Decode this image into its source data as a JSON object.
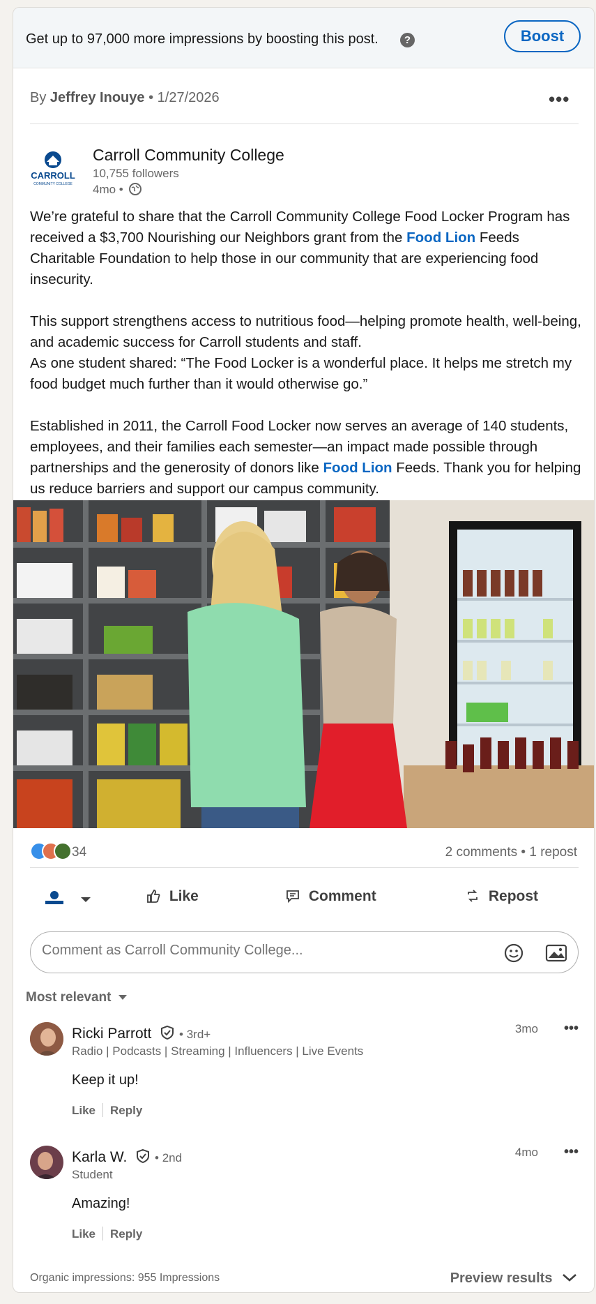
{
  "boost_bar": {
    "text": "Get up to 97,000 more impressions by boosting this post.",
    "help_icon": "question-circle-icon",
    "button": "Boost"
  },
  "byline": {
    "prefix": "By",
    "author": "Jeffrey Inouye",
    "sep": "•",
    "date": "1/27/2026"
  },
  "org": {
    "logo_text": "CARROLL",
    "logo_subtext": "COMMUNITY COLLEGE",
    "name": "Carroll Community College",
    "followers": "10,755 followers",
    "age": "4mo •"
  },
  "post": {
    "p1_a": "We’re grateful to share that the Carroll Community College Food Locker Program has received a $3,700 Nourishing our Neighbors grant from the ",
    "p1_link": "Food Lion",
    "p1_b": " Feeds Charitable Foundation to help those in our community that are experiencing food insecurity.",
    "p2_line1": "This support strengthens access to nutritious food—helping promote health, well-being, and academic success for Carroll students and staff.",
    "p2_line2": "As one student shared: “The Food Locker is a wonderful place. It helps me stretch my food budget much further than it would otherwise go.”",
    "p3_a": "Established in 2011, the Carroll Food Locker now serves an average of 140 students, employees, and their families each semester—an impact made possible through partnerships and the generosity of donors like ",
    "p3_link": "Food Lion",
    "p3_b": " Feeds. Thank you for helping us reduce barriers and support our campus community."
  },
  "social": {
    "reaction_count": "34",
    "comments_reposts": "2 comments • 1 repost"
  },
  "actions": {
    "like": "Like",
    "comment": "Comment",
    "repost": "Repost"
  },
  "comment_box": {
    "placeholder": "Comment as Carroll Community College..."
  },
  "sort_label": "Most relevant",
  "comments": [
    {
      "name": "Ricki Parrott",
      "degree": "• 3rd+",
      "headline": "Radio | Podcasts | Streaming | Influencers | Live Events",
      "time": "3mo",
      "body": "Keep it up!",
      "like": "Like",
      "reply": "Reply"
    },
    {
      "name": "Karla W.",
      "degree": "• 2nd",
      "headline": "Student",
      "time": "4mo",
      "body": "Amazing!",
      "like": "Like",
      "reply": "Reply"
    }
  ],
  "footer": {
    "impressions": "Organic impressions: 955 Impressions",
    "preview": "Preview results"
  },
  "colors": {
    "brand": "#0a66c2",
    "text": "#191919",
    "muted": "#666666"
  }
}
